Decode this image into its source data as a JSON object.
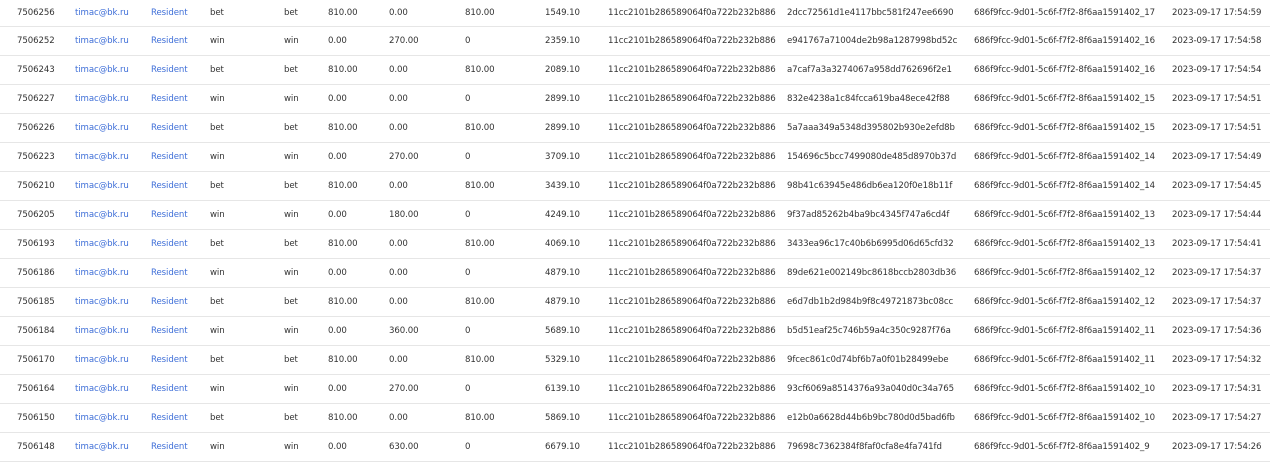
{
  "colors": {
    "link": "#3f6fd8",
    "text": "#333333",
    "border": "#e6e6e6"
  },
  "rows": [
    [
      "7506256",
      "timac@bk.ru",
      "Resident",
      "bet",
      "bet",
      "810.00",
      "0.00",
      "810.00",
      "1549.10",
      "11cc2101b286589064f0a722b232b886",
      "2dcc72561d1e4117bbc581f247ee6690",
      "686f9fcc-9d01-5c6f-f7f2-8f6aa1591402_17",
      "2023-09-17 17:54:59"
    ],
    [
      "7506252",
      "timac@bk.ru",
      "Resident",
      "win",
      "win",
      "0.00",
      "270.00",
      "0",
      "2359.10",
      "11cc2101b286589064f0a722b232b886",
      "e941767a71004de2b98a1287998bd52c",
      "686f9fcc-9d01-5c6f-f7f2-8f6aa1591402_16",
      "2023-09-17 17:54:58"
    ],
    [
      "7506243",
      "timac@bk.ru",
      "Resident",
      "bet",
      "bet",
      "810.00",
      "0.00",
      "810.00",
      "2089.10",
      "11cc2101b286589064f0a722b232b886",
      "a7caf7a3a3274067a958dd762696f2e1",
      "686f9fcc-9d01-5c6f-f7f2-8f6aa1591402_16",
      "2023-09-17 17:54:54"
    ],
    [
      "7506227",
      "timac@bk.ru",
      "Resident",
      "win",
      "win",
      "0.00",
      "0.00",
      "0",
      "2899.10",
      "11cc2101b286589064f0a722b232b886",
      "832e4238a1c84fcca619ba48ece42f88",
      "686f9fcc-9d01-5c6f-f7f2-8f6aa1591402_15",
      "2023-09-17 17:54:51"
    ],
    [
      "7506226",
      "timac@bk.ru",
      "Resident",
      "bet",
      "bet",
      "810.00",
      "0.00",
      "810.00",
      "2899.10",
      "11cc2101b286589064f0a722b232b886",
      "5a7aaa349a5348d395802b930e2efd8b",
      "686f9fcc-9d01-5c6f-f7f2-8f6aa1591402_15",
      "2023-09-17 17:54:51"
    ],
    [
      "7506223",
      "timac@bk.ru",
      "Resident",
      "win",
      "win",
      "0.00",
      "270.00",
      "0",
      "3709.10",
      "11cc2101b286589064f0a722b232b886",
      "154696c5bcc7499080de485d8970b37d",
      "686f9fcc-9d01-5c6f-f7f2-8f6aa1591402_14",
      "2023-09-17 17:54:49"
    ],
    [
      "7506210",
      "timac@bk.ru",
      "Resident",
      "bet",
      "bet",
      "810.00",
      "0.00",
      "810.00",
      "3439.10",
      "11cc2101b286589064f0a722b232b886",
      "98b41c63945e486db6ea120f0e18b11f",
      "686f9fcc-9d01-5c6f-f7f2-8f6aa1591402_14",
      "2023-09-17 17:54:45"
    ],
    [
      "7506205",
      "timac@bk.ru",
      "Resident",
      "win",
      "win",
      "0.00",
      "180.00",
      "0",
      "4249.10",
      "11cc2101b286589064f0a722b232b886",
      "9f37ad85262b4ba9bc4345f747a6cd4f",
      "686f9fcc-9d01-5c6f-f7f2-8f6aa1591402_13",
      "2023-09-17 17:54:44"
    ],
    [
      "7506193",
      "timac@bk.ru",
      "Resident",
      "bet",
      "bet",
      "810.00",
      "0.00",
      "810.00",
      "4069.10",
      "11cc2101b286589064f0a722b232b886",
      "3433ea96c17c40b6b6995d06d65cfd32",
      "686f9fcc-9d01-5c6f-f7f2-8f6aa1591402_13",
      "2023-09-17 17:54:41"
    ],
    [
      "7506186",
      "timac@bk.ru",
      "Resident",
      "win",
      "win",
      "0.00",
      "0.00",
      "0",
      "4879.10",
      "11cc2101b286589064f0a722b232b886",
      "89de621e002149bc8618bccb2803db36",
      "686f9fcc-9d01-5c6f-f7f2-8f6aa1591402_12",
      "2023-09-17 17:54:37"
    ],
    [
      "7506185",
      "timac@bk.ru",
      "Resident",
      "bet",
      "bet",
      "810.00",
      "0.00",
      "810.00",
      "4879.10",
      "11cc2101b286589064f0a722b232b886",
      "e6d7db1b2d984b9f8c49721873bc08cc",
      "686f9fcc-9d01-5c6f-f7f2-8f6aa1591402_12",
      "2023-09-17 17:54:37"
    ],
    [
      "7506184",
      "timac@bk.ru",
      "Resident",
      "win",
      "win",
      "0.00",
      "360.00",
      "0",
      "5689.10",
      "11cc2101b286589064f0a722b232b886",
      "b5d51eaf25c746b59a4c350c9287f76a",
      "686f9fcc-9d01-5c6f-f7f2-8f6aa1591402_11",
      "2023-09-17 17:54:36"
    ],
    [
      "7506170",
      "timac@bk.ru",
      "Resident",
      "bet",
      "bet",
      "810.00",
      "0.00",
      "810.00",
      "5329.10",
      "11cc2101b286589064f0a722b232b886",
      "9fcec861c0d74bf6b7a0f01b28499ebe",
      "686f9fcc-9d01-5c6f-f7f2-8f6aa1591402_11",
      "2023-09-17 17:54:32"
    ],
    [
      "7506164",
      "timac@bk.ru",
      "Resident",
      "win",
      "win",
      "0.00",
      "270.00",
      "0",
      "6139.10",
      "11cc2101b286589064f0a722b232b886",
      "93cf6069a8514376a93a040d0c34a765",
      "686f9fcc-9d01-5c6f-f7f2-8f6aa1591402_10",
      "2023-09-17 17:54:31"
    ],
    [
      "7506150",
      "timac@bk.ru",
      "Resident",
      "bet",
      "bet",
      "810.00",
      "0.00",
      "810.00",
      "5869.10",
      "11cc2101b286589064f0a722b232b886",
      "e12b0a6628d44b6b9bc780d0d5bad6fb",
      "686f9fcc-9d01-5c6f-f7f2-8f6aa1591402_10",
      "2023-09-17 17:54:27"
    ],
    [
      "7506148",
      "timac@bk.ru",
      "Resident",
      "win",
      "win",
      "0.00",
      "630.00",
      "0",
      "6679.10",
      "11cc2101b286589064f0a722b232b886",
      "79698c7362384f8faf0cfa8e4fa741fd",
      "686f9fcc-9d01-5c6f-f7f2-8f6aa1591402_9",
      "2023-09-17 17:54:26"
    ]
  ]
}
